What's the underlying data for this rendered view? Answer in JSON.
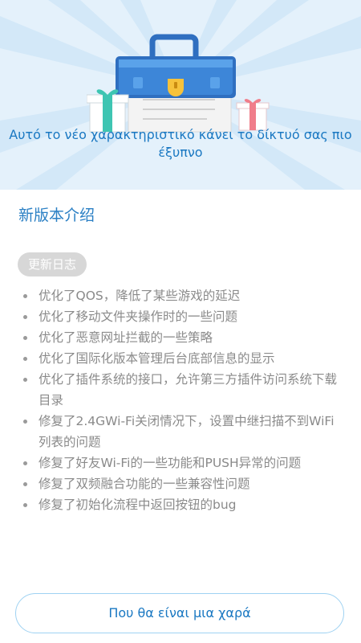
{
  "hero": {
    "message": "Αυτό το νέο χαρακτηριστικό κάνει το δίκτυό σας πιο έξυπνο"
  },
  "content": {
    "title": "新版本介绍",
    "badge": "更新日志",
    "changes": [
      "优化了QOS，降低了某些游戏的延迟",
      "优化了移动文件夹操作时的一些问题",
      "优化了恶意网址拦截的一些策略",
      "优化了国际化版本管理后台底部信息的显示",
      "优化了插件系统的接口，允许第三方插件访问系统下载目录",
      "修复了2.4GWi-Fi关闭情况下，设置中继扫描不到WiFi列表的问题",
      "修复了好友Wi-Fi的一些功能和PUSH异常的问题",
      "修复了双频融合功能的一些兼容性问题",
      "修复了初始化流程中返回按钮的bug"
    ]
  },
  "footer": {
    "button_label": "Που θα είναι μια χαρά"
  },
  "colors": {
    "hero_bg": "#e4f1fb",
    "accent": "#1a78c2",
    "button_border": "#9fd2f2",
    "badge_bg": "#d7d7d7",
    "text_muted": "#8a8a8a"
  },
  "icons": {
    "toolbox": "toolbox-icon",
    "gift_left": "gift-icon",
    "gift_right": "gift-icon"
  }
}
